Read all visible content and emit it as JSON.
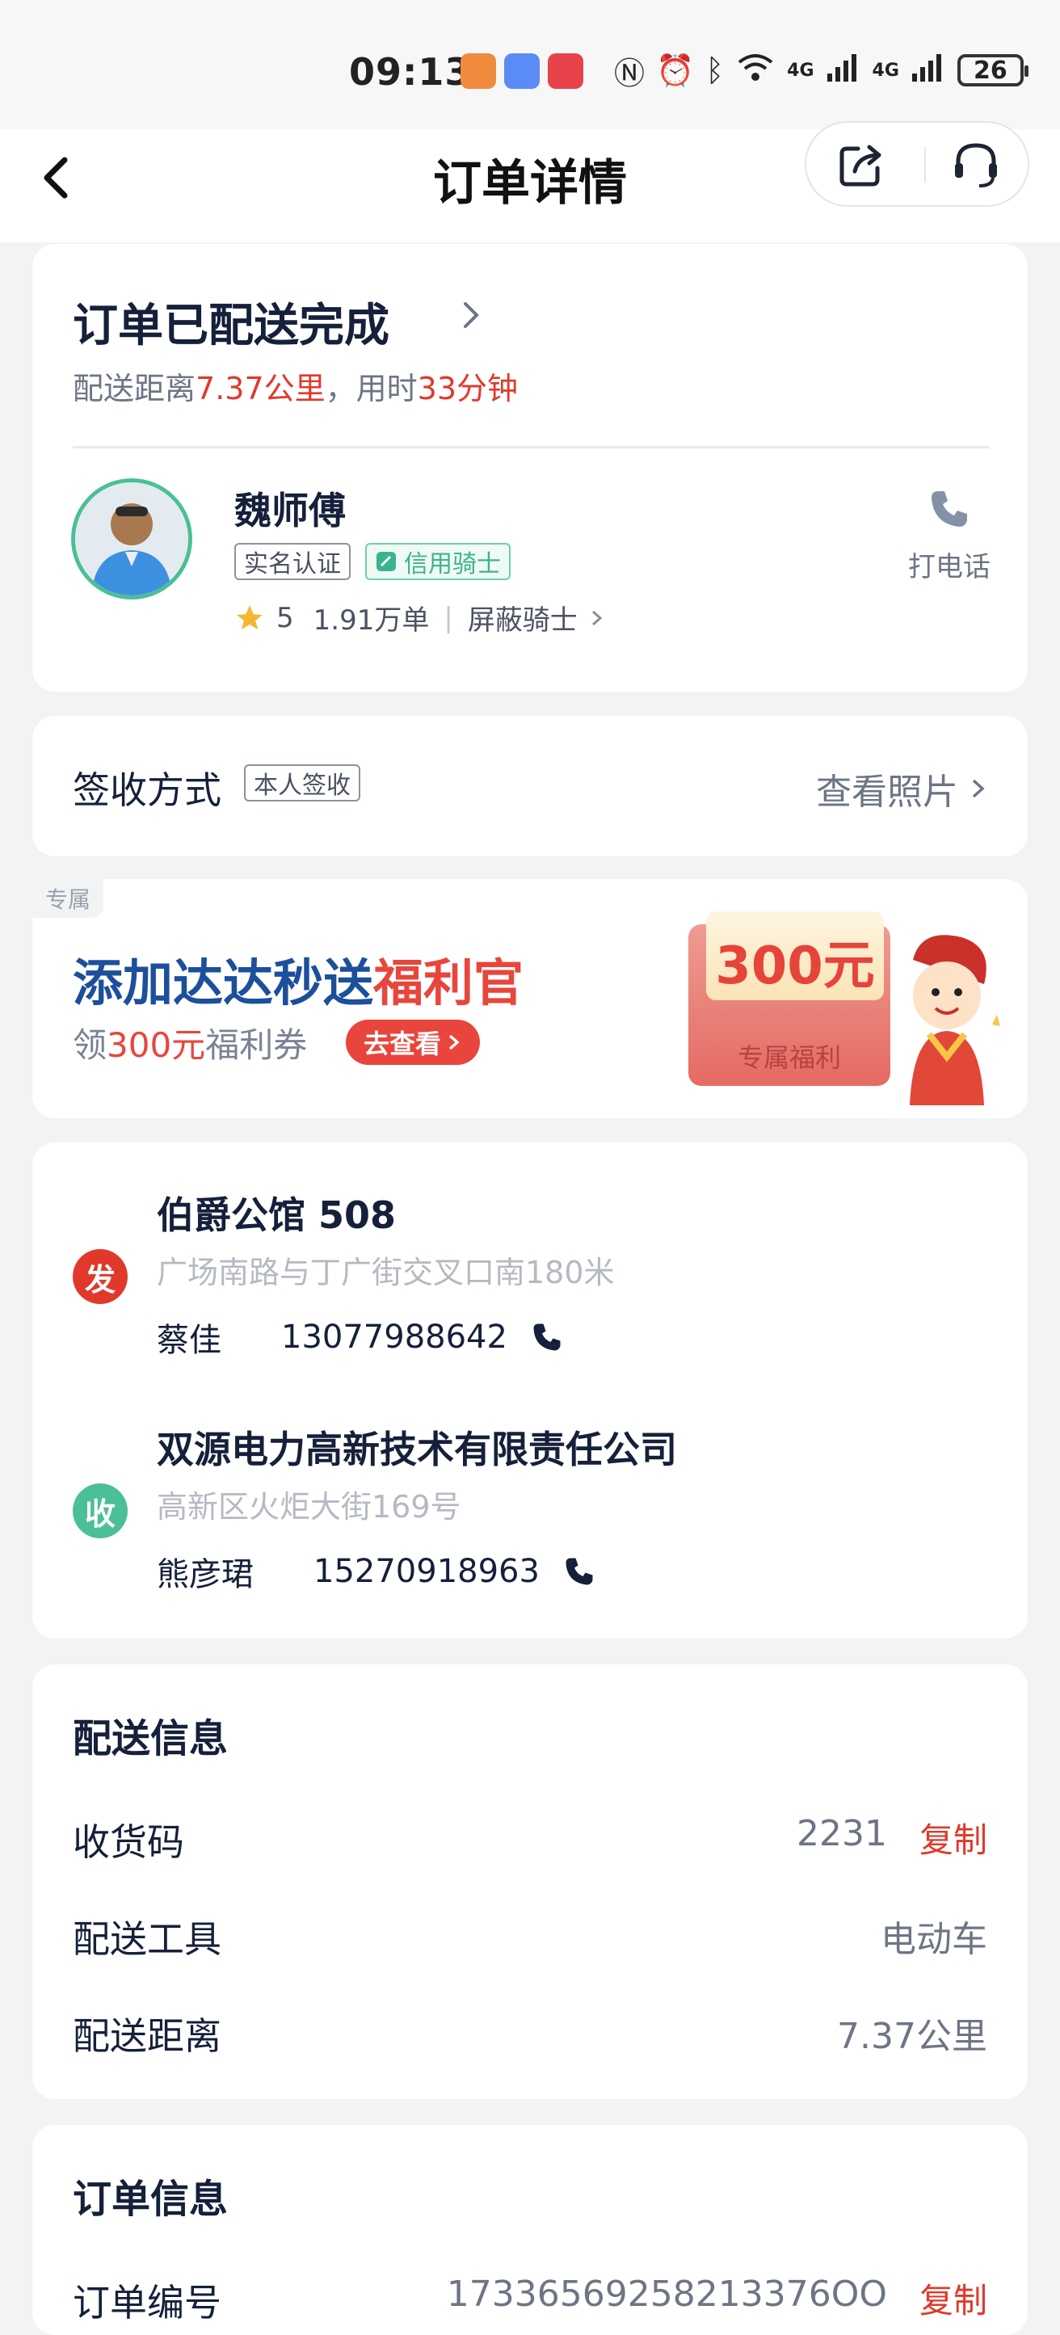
{
  "status_bar": {
    "time": "09:13",
    "network_1": "4G",
    "network_2": "4G",
    "battery": "26"
  },
  "nav": {
    "title": "订单详情",
    "icons": [
      "back-icon",
      "share-icon",
      "customer-service-icon"
    ]
  },
  "status_card": {
    "title": "订单已配送完成",
    "sub_prefix": "配送距离",
    "distance": "7.37公里",
    "sub_mid": "，用时",
    "duration": "33分钟",
    "rider": {
      "name": "魏师傅",
      "tag_verified": "实名认证",
      "tag_credit": "信用骑士",
      "rating": "5",
      "orders": "1.91万单",
      "block_label": "屏蔽骑士"
    },
    "call_label": "打电话"
  },
  "sign_card": {
    "label": "签收方式",
    "tag": "本人签收",
    "action": "查看照片"
  },
  "promo": {
    "corner": "专属",
    "title_main": "添加达达秒送",
    "title_highlight": "福利官",
    "sub_prefix": "领",
    "sub_amount": "300元",
    "sub_suffix": "福利券",
    "button": "去查看",
    "envelope_amount": "300元",
    "envelope_label": "专属福利"
  },
  "addresses": {
    "sender": {
      "badge": "发",
      "name": "伯爵公馆 508",
      "detail": "广场南路与丁广街交叉口南180米",
      "contact_name": "蔡佳",
      "phone": "13077988642"
    },
    "receiver": {
      "badge": "收",
      "name": "双源电力高新技术有限责任公司",
      "detail": "高新区火炬大街169号",
      "contact_name": "熊彦珺",
      "phone": "15270918963"
    }
  },
  "delivery_info": {
    "title": "配送信息",
    "code_label": "收货码",
    "code_value": "2231",
    "copy": "复制",
    "tool_label": "配送工具",
    "tool_value": "电动车",
    "distance_label": "配送距离",
    "distance_value": "7.37公里"
  },
  "order_info": {
    "title": "订单信息",
    "number_label": "订单编号",
    "number_value": "17336569258213376OO",
    "copy": "复制"
  },
  "colors": {
    "accent_red": "#e0392b",
    "green": "#4bbf95",
    "text_dark": "#15203a",
    "text_muted": "#6d7585"
  }
}
